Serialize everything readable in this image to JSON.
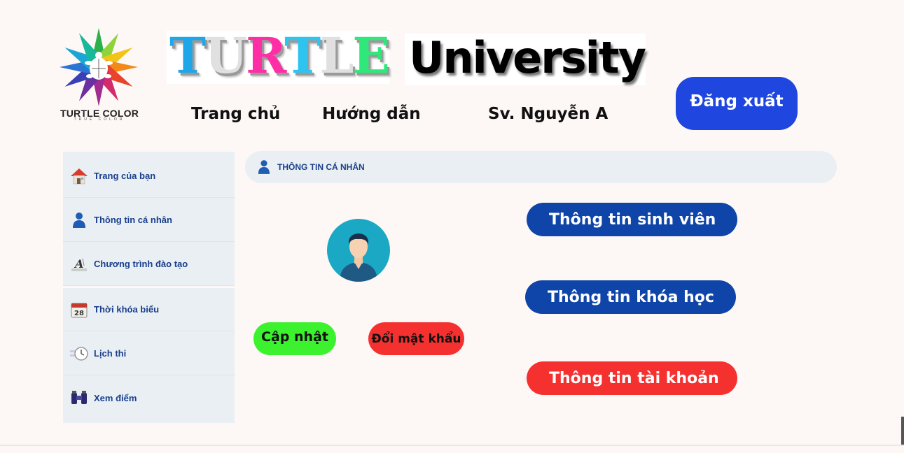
{
  "brand": {
    "logo_text": "TURTLE COLOR",
    "logo_subtext": "TRUE COLOR",
    "title_word1": "TURTLE",
    "title_word2": "University",
    "turtle_letter_colors": [
      "#1ea7e8",
      "#e0e0e0",
      "#ff2ea6",
      "#2ec4f0",
      "#e0e0e0",
      "#2ee87a"
    ]
  },
  "nav": {
    "home": "Trang chủ",
    "guide": "Hướng dẫn",
    "user": "Sv. Nguyễn A",
    "logout": "Đăng xuất"
  },
  "sidebar": {
    "items": [
      {
        "label": "Trang của bạn",
        "icon": "home-icon"
      },
      {
        "label": "Thông tin cá nhân",
        "icon": "user-icon"
      },
      {
        "label": "Chương trình đào tạo",
        "icon": "font-icon"
      },
      {
        "label": "Thời khóa biểu",
        "icon": "calendar-icon"
      },
      {
        "label": "Lịch thi",
        "icon": "clock-icon"
      },
      {
        "label": "Xem điểm",
        "icon": "binoculars-icon"
      }
    ]
  },
  "section": {
    "header": "THÔNG TIN CÁ NHÂN"
  },
  "actions": {
    "update": "Cập nhật",
    "change_password": "Đổi mật khẩu",
    "student_info": "Thông tin sinh viên",
    "course_info": "Thông tin khóa học",
    "account_info": "Thông tin tài khoản"
  },
  "colors": {
    "primary_blue": "#1f47e0",
    "dark_blue": "#0f45a8",
    "green": "#3cf22f",
    "red": "#f53130",
    "sidebar_bg": "#e9eff3",
    "link_blue": "#1a3f8c"
  }
}
